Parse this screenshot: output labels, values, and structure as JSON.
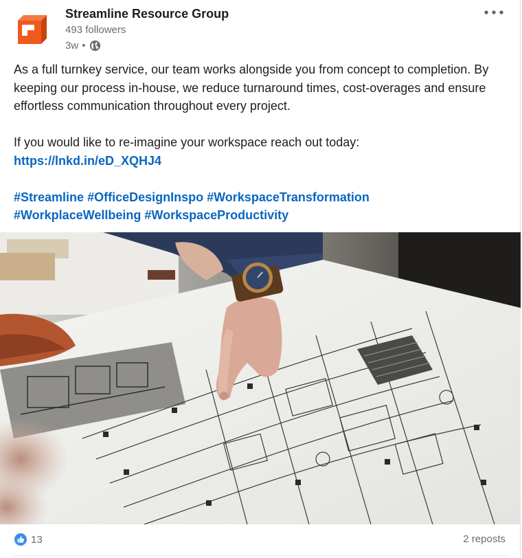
{
  "post": {
    "author": {
      "name": "Streamline Resource Group",
      "followers": "493 followers",
      "time_ago": "3w",
      "separator": "•",
      "logo_icon": "streamline-logo-icon",
      "visibility_icon": "globe-icon"
    },
    "menu_icon": "more-options-icon",
    "text": {
      "paragraph_1": "As a full turnkey service, our team works alongside you from concept to completion. By keeping our process in-house, we reduce turnaround times, cost-overages and ensure effortless communication throughout every project.",
      "paragraph_2": "If you would like to re-imagine your workspace reach out today:",
      "link": "https://lnkd.in/eD_XQHJ4",
      "hashtags_line_1": [
        "#Streamline",
        "#OfficeDesignInspo",
        "#WorkspaceTransformation"
      ],
      "hashtags_line_2": [
        "#WorkplaceWellbeing",
        "#WorkspaceProductivity"
      ]
    },
    "image": {
      "subject": "hand-pointing-at-floor-plan-photo"
    },
    "social": {
      "reaction_icon": "like-icon",
      "reaction_count": "13",
      "reposts": "2 reposts"
    }
  },
  "colors": {
    "link": "#0a66c2",
    "logo_orange": "#ef5a1f",
    "logo_dark_orange": "#c9430f",
    "muted_text": "#6b6b6b"
  }
}
